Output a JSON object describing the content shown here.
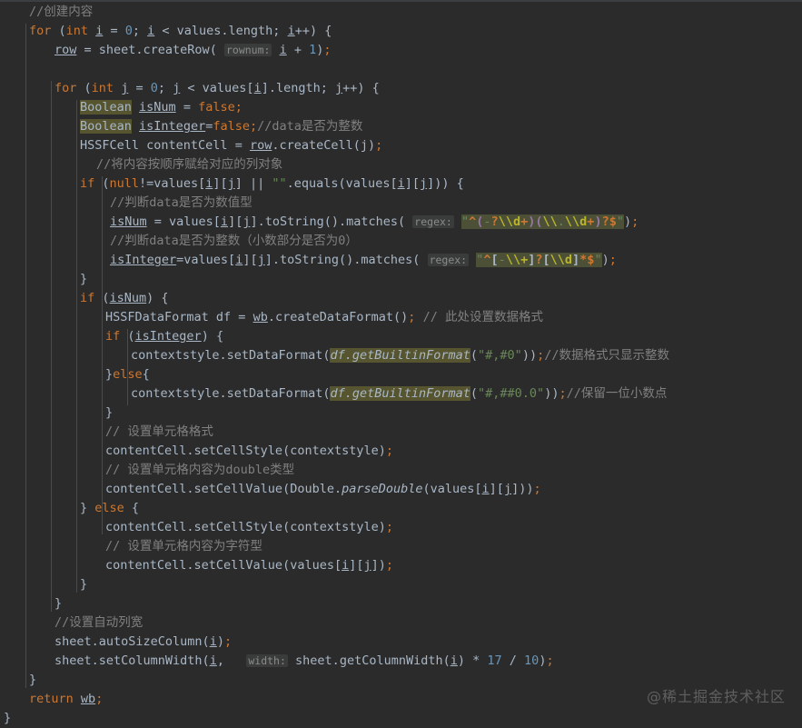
{
  "editor": {
    "language": "java",
    "theme": "darcula",
    "background_color": "#2b2b2b",
    "default_text_color": "#a9b7c6",
    "highlight_color": "#56552f",
    "regex_highlight_color": "#4c5037"
  },
  "watermark": {
    "text": "@稀土掘金技术社区"
  },
  "lines": {
    "l1": "//创建内容",
    "l2_for": "for",
    "l2_a": " (",
    "l2_int": "int",
    "l2_i1": "i",
    "l2_b": " = ",
    "l2_0": "0",
    "l2_c": "; ",
    "l2_i2": "i",
    "l2_d": " < values.length; ",
    "l2_i3": "i",
    "l2_e": "++) {",
    "l3_row": "row",
    "l3_a": " = sheet.createRow(",
    "l3_hint": "rownum:",
    "l3_i": "i",
    "l3_b": " + ",
    "l3_1": "1",
    "l3_c": ")",
    "l3_semi": ";",
    "l5_for": "for",
    "l5_a": " (",
    "l5_int": "int",
    "l5_j1": "j",
    "l5_b": " = ",
    "l5_0": "0",
    "l5_c": "; ",
    "l5_j2": "j",
    "l5_d": " < values[",
    "l5_i": "i",
    "l5_e": "].length; ",
    "l5_j3": "j",
    "l5_f": "++) {",
    "l6_type": "Boolean",
    "l6_sp": " ",
    "l6_var": "isNum",
    "l6_eq": " = ",
    "l6_false": "false",
    "l6_semi": ";",
    "l7_type": "Boolean",
    "l7_sp": " ",
    "l7_var": "isInteger",
    "l7_eq": "=",
    "l7_false": "false",
    "l7_semi": ";",
    "l7_cmt": "//data是否为整数",
    "l8_type": "HSSFCell",
    "l8_a": " contentCell = ",
    "l8_row": "row",
    "l8_b": ".createCell(j)",
    "l8_semi": ";",
    "l9_cmt": "//将内容按顺序赋给对应的列对象",
    "l10_if": "if",
    "l10_a": " (",
    "l10_null": "null",
    "l10_b": "!=values[",
    "l10_i": "i",
    "l10_c": "][",
    "l10_j": "j",
    "l10_d": "] || ",
    "l10_str": "\"\"",
    "l10_e": ".equals(values[",
    "l10_i2": "i",
    "l10_f": "][",
    "l10_j2": "j",
    "l10_g": "])) {",
    "l11_cmt": "//判断data是否为数值型",
    "l12_var": "isNum",
    "l12_a": " = values[",
    "l12_i": "i",
    "l12_b": "][",
    "l12_j": "j",
    "l12_c": "].toString().matches(",
    "l12_hint": "regex:",
    "l12_regex": "\"^(-?\\\\d+)(\\\\.\\\\d+)?$\"",
    "l12_d": ")",
    "l12_semi": ";",
    "l13_cmt": "//判断data是否为整数（小数部分是否为0）",
    "l14_var": "isInteger",
    "l14_a": "=values[",
    "l14_i": "i",
    "l14_b": "][",
    "l14_j": "j",
    "l14_c": "].toString().matches(",
    "l14_hint": "regex:",
    "l14_regex": "\"^[-\\\\+]?[\\\\d]*$\"",
    "l14_d": ")",
    "l14_semi": ";",
    "l15_close": "}",
    "l16_if": "if",
    "l16_a": " (",
    "l16_var": "isNum",
    "l16_b": ") {",
    "l17_type": "HSSFDataFormat",
    "l17_a": " df = ",
    "l17_wb": "wb",
    "l17_b": ".createDataFormat()",
    "l17_semi": ";",
    "l17_cmt": "// 此处设置数据格式",
    "l18_if": "if",
    "l18_a": " (",
    "l18_var": "isInteger",
    "l18_b": ") {",
    "l19_a": "contextstyle.setDataFormat(",
    "l19_hl": "df.getBuiltinFormat",
    "l19_b": "(",
    "l19_str": "\"#,#0\"",
    "l19_c": "))",
    "l19_semi": ";",
    "l19_cmt": "//数据格式只显示整数",
    "l20_close": "}",
    "l20_else": "else",
    "l20_open": "{",
    "l21_a": "contextstyle.setDataFormat(",
    "l21_hl": "df.getBuiltinFormat",
    "l21_b": "(",
    "l21_str": "\"#,##0.0\"",
    "l21_c": "))",
    "l21_semi": ";",
    "l21_cmt": "//保留一位小数点",
    "l22_close": "}",
    "l23_cmt": "// 设置单元格格式",
    "l24_a": "contentCell.setCellStyle(contextstyle)",
    "l24_semi": ";",
    "l25_cmt": "// 设置单元格内容为double类型",
    "l26_a": "contentCell.setCellValue(Double.",
    "l26_m": "parseDouble",
    "l26_b": "(values[",
    "l26_i": "i",
    "l26_c": "][",
    "l26_j": "j",
    "l26_d": "]))",
    "l26_semi": ";",
    "l27_close": "} ",
    "l27_else": "else",
    "l27_open": " {",
    "l28_a": "contentCell.setCellStyle(contextstyle)",
    "l28_semi": ";",
    "l29_cmt": "// 设置单元格内容为字符型",
    "l30_a": "contentCell.setCellValue(values[",
    "l30_i": "i",
    "l30_b": "][",
    "l30_j": "j",
    "l30_c": "])",
    "l30_semi": ";",
    "l31_close": "}",
    "l32_close": "}",
    "l33_cmt": "//设置自动列宽",
    "l34_a": "sheet.autoSizeColumn(",
    "l34_i": "i",
    "l34_b": ")",
    "l34_semi": ";",
    "l35_a": "sheet.setColumnWidth(",
    "l35_i": "i",
    "l35_comma": ", ",
    "l35_hint": "width:",
    "l35_b": "sheet.getColumnWidth(",
    "l35_i2": "i",
    "l35_c": ") * ",
    "l35_17": "17",
    "l35_d": " / ",
    "l35_10": "10",
    "l35_e": ")",
    "l35_semi": ";",
    "l36_close": "}",
    "l37_return": "return",
    "l37_sp": " ",
    "l37_wb": "wb",
    "l37_semi": ";",
    "l38_close": "}"
  }
}
